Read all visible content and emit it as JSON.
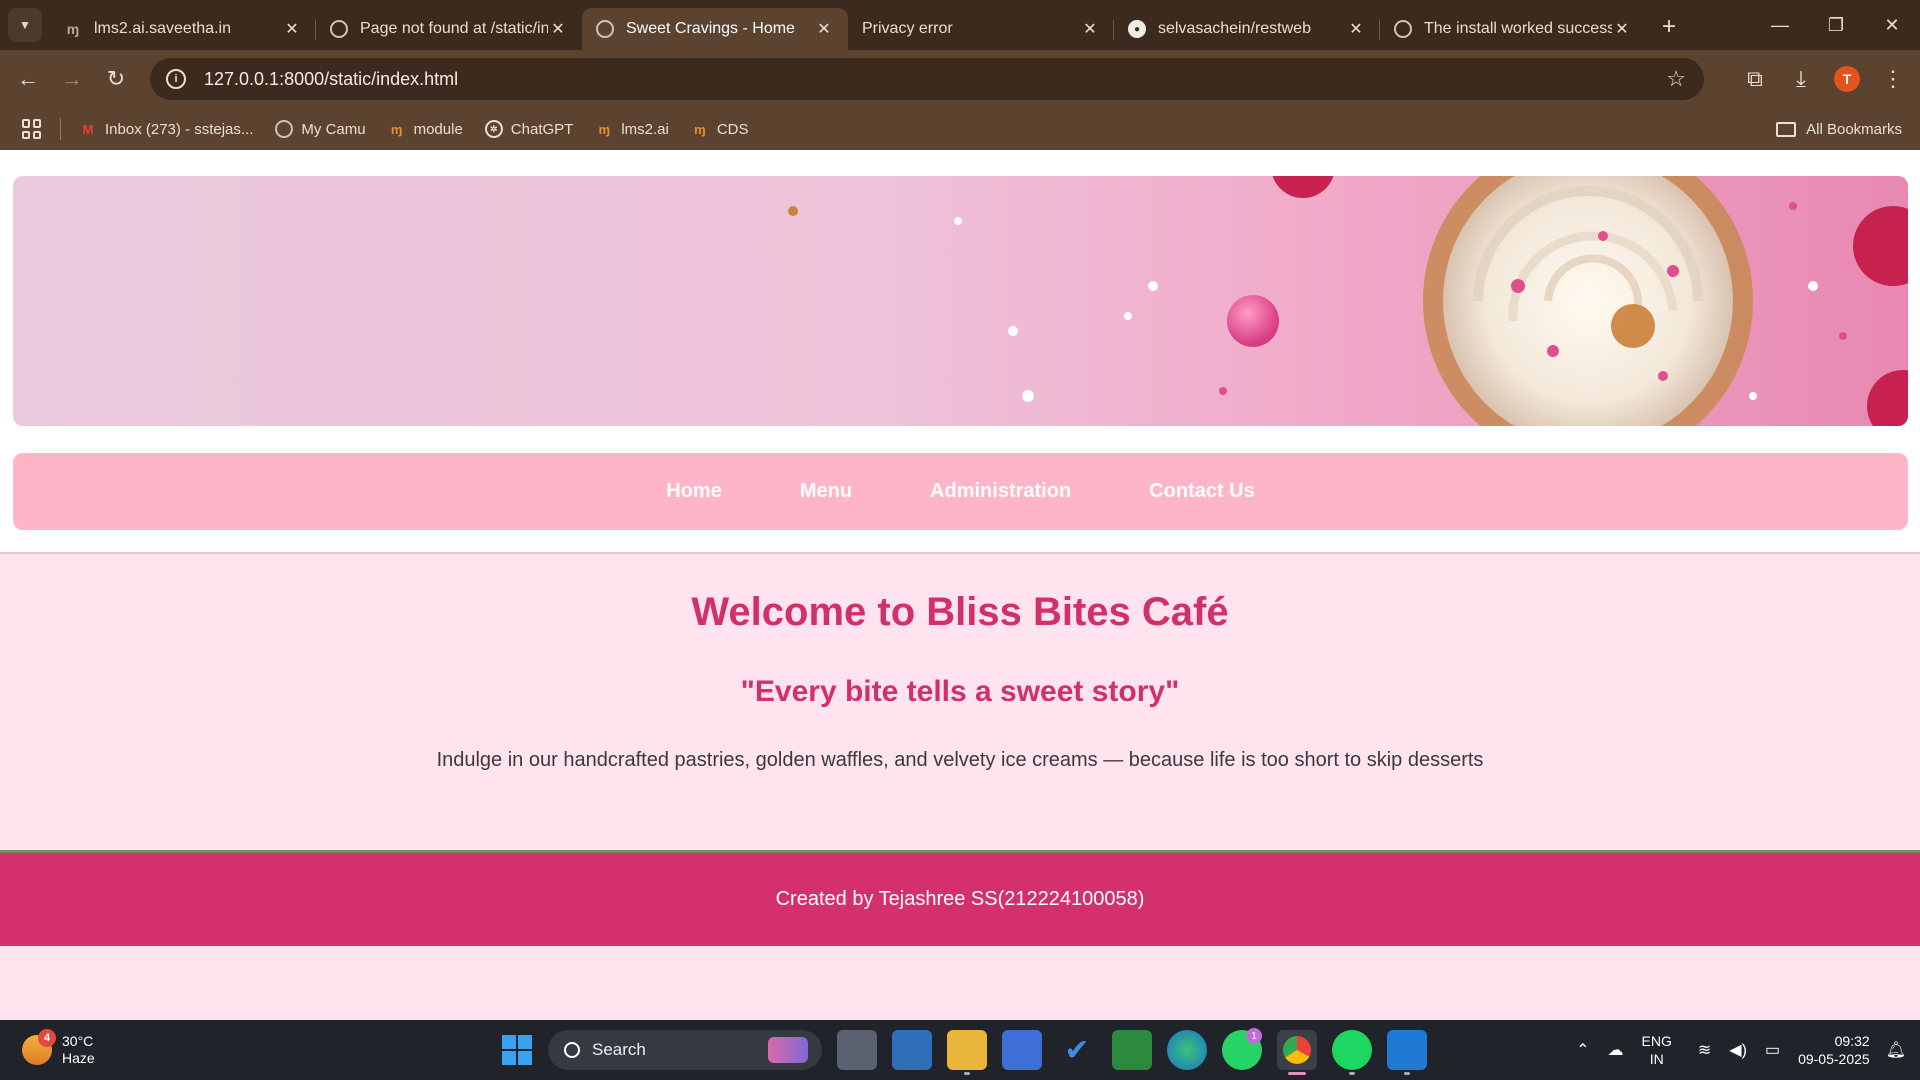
{
  "browser": {
    "tabs": [
      {
        "title": "lms2.ai.saveetha.in",
        "favicon": "m-logo-icon",
        "active": false
      },
      {
        "title": "Page not found at /static/in",
        "favicon": "globe-icon",
        "active": false
      },
      {
        "title": "Sweet Cravings - Home",
        "favicon": "globe-icon",
        "active": true
      },
      {
        "title": "Privacy error",
        "favicon": "none",
        "active": false
      },
      {
        "title": "selvasachein/restweb",
        "favicon": "github-icon",
        "active": false
      },
      {
        "title": "The install worked successfu",
        "favicon": "globe-icon",
        "active": false
      }
    ],
    "address": "127.0.0.1:8000/static/index.html",
    "profile_initial": "T",
    "bookmarks": [
      {
        "label": "Inbox (273) - sstejas...",
        "icon": "gmail-icon"
      },
      {
        "label": "My Camu",
        "icon": "globe-icon"
      },
      {
        "label": "module",
        "icon": "m-logo-icon"
      },
      {
        "label": "ChatGPT",
        "icon": "chatgpt-icon"
      },
      {
        "label": "lms2.ai",
        "icon": "m-logo-icon"
      },
      {
        "label": "CDS",
        "icon": "m-logo-icon"
      }
    ],
    "all_bookmarks": "All Bookmarks"
  },
  "page": {
    "nav": [
      "Home",
      "Menu",
      "Administration",
      "Contact Us"
    ],
    "heading": "Welcome to Bliss Bites Café",
    "tagline": "\"Every bite tells a sweet story\"",
    "intro": "Indulge in our handcrafted pastries, golden waffles, and velvety ice creams — because life is too short to skip desserts",
    "footer": "Created by Tejashree SS(212224100058)",
    "colors": {
      "accent": "#d13069",
      "nav_bg": "#ffb5c8",
      "page_bg": "#ffe4ef",
      "footer_bg": "#d4306b"
    }
  },
  "taskbar": {
    "weather_temp": "30°C",
    "weather_desc": "Haze",
    "weather_badge": "4",
    "search_label": "Search",
    "whatsapp_badge": "1",
    "lang_top": "ENG",
    "lang_bottom": "IN",
    "time": "09:32",
    "date": "09-05-2025"
  }
}
